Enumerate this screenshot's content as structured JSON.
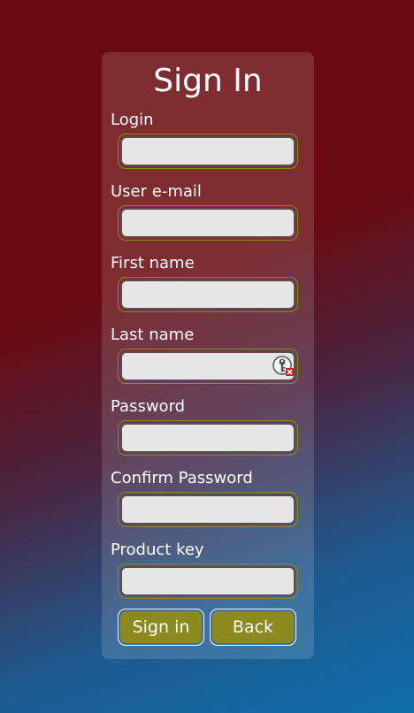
{
  "form": {
    "title": "Sign In",
    "fields": [
      {
        "label": "Login",
        "value": ""
      },
      {
        "label": "User e-mail",
        "value": ""
      },
      {
        "label": "First name",
        "value": ""
      },
      {
        "label": "Last name",
        "value": ""
      },
      {
        "label": "Password",
        "value": ""
      },
      {
        "label": "Confirm Password",
        "value": ""
      },
      {
        "label": "Product key",
        "value": ""
      }
    ],
    "sign_in_label": "Sign in",
    "back_label": "Back"
  },
  "colors": {
    "background_top": "#6b0a10",
    "background_bottom": "#0f6eaa",
    "button": "#8b8a1f",
    "input_bg": "#e6e6e6"
  },
  "icons": {
    "last_name_field": "key-with-red-x-icon"
  }
}
